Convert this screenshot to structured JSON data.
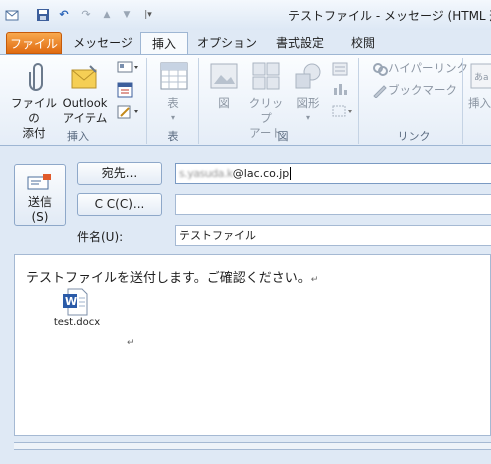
{
  "window": {
    "title": "テストファイル - メッセージ (HTML 形"
  },
  "tabs": [
    {
      "label": "ファイル"
    },
    {
      "label": "メッセージ"
    },
    {
      "label": "挿入"
    },
    {
      "label": "オプション"
    },
    {
      "label": "書式設定"
    },
    {
      "label": "校閲"
    }
  ],
  "ribbon": {
    "insert_group": {
      "label": "挿入",
      "attach_file": [
        "ファイルの",
        "添付"
      ],
      "outlook_item": [
        "Outlook",
        "アイテム"
      ]
    },
    "table_group": {
      "label": "表",
      "table": "表"
    },
    "illustrations_group": {
      "label": "図",
      "picture": "図",
      "clipart": [
        "クリップ",
        "アート"
      ],
      "shapes": "図形"
    },
    "links_group": {
      "label": "リンク",
      "hyperlink": "ハイパーリンク",
      "bookmark": "ブックマーク"
    },
    "text_group": {
      "insert": "挿入"
    }
  },
  "compose": {
    "send_label": [
      "送信",
      "(S)"
    ],
    "to_label": "宛先...",
    "cc_label": "C C(C)...",
    "to_value": "@lac.co.jp",
    "to_obscured_prefix": "s.yasuda.k",
    "cc_value": "",
    "subject_label": "件名(U):",
    "subject_value": "テストファイル"
  },
  "body": {
    "text": "テストファイルを送付します。ご確認ください。",
    "return_mark": "↵",
    "attachment_name": "test.docx"
  }
}
